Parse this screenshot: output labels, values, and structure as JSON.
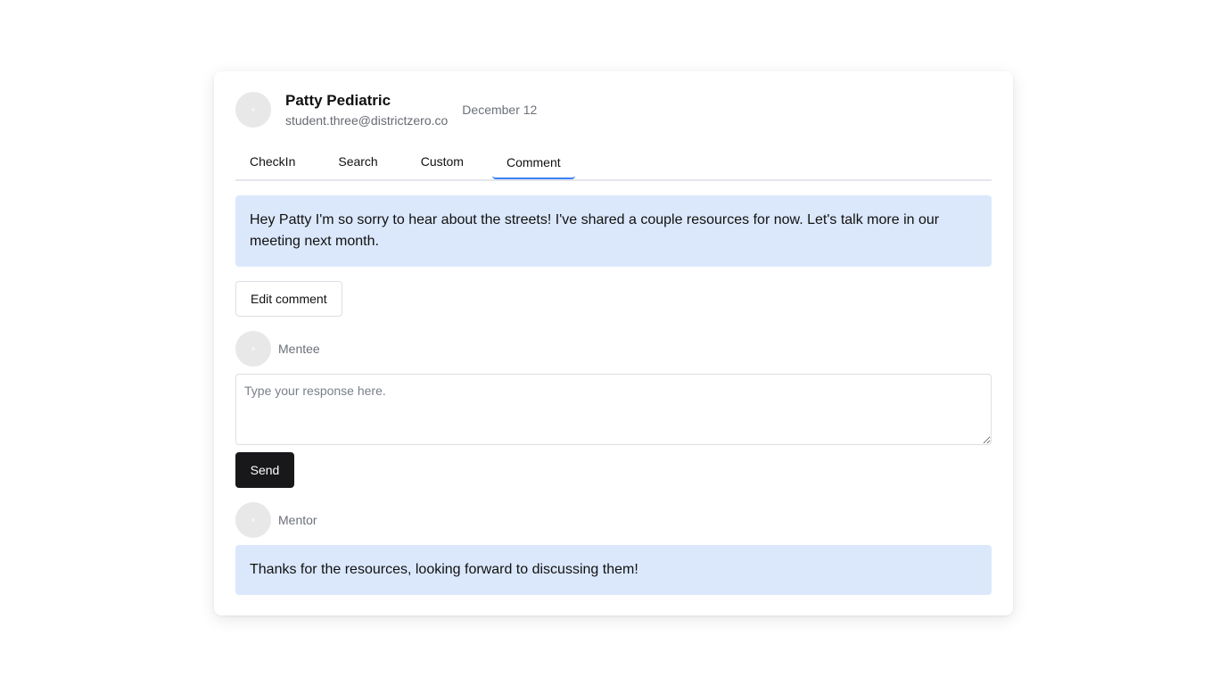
{
  "header": {
    "name": "Patty Pediatric",
    "email": "student.three@districtzero.co",
    "date": "December 12"
  },
  "tabs": [
    {
      "label": "CheckIn",
      "active": false
    },
    {
      "label": "Search",
      "active": false
    },
    {
      "label": "Custom",
      "active": false
    },
    {
      "label": "Comment",
      "active": true
    }
  ],
  "comment": {
    "text": "Hey Patty I'm so sorry to hear about the streets! I've shared a couple resources for now. Let's talk more in our meeting next month.",
    "edit_label": "Edit comment"
  },
  "mentee": {
    "label": "Mentee",
    "placeholder": "Type your response here.",
    "value": "",
    "send_label": "Send"
  },
  "mentor": {
    "label": "Mentor",
    "reply": "Thanks for the resources, looking forward to discussing them!"
  },
  "colors": {
    "accent": "#3b82f6",
    "comment_bg": "#dbe8fc",
    "send_bg": "#18181b"
  }
}
